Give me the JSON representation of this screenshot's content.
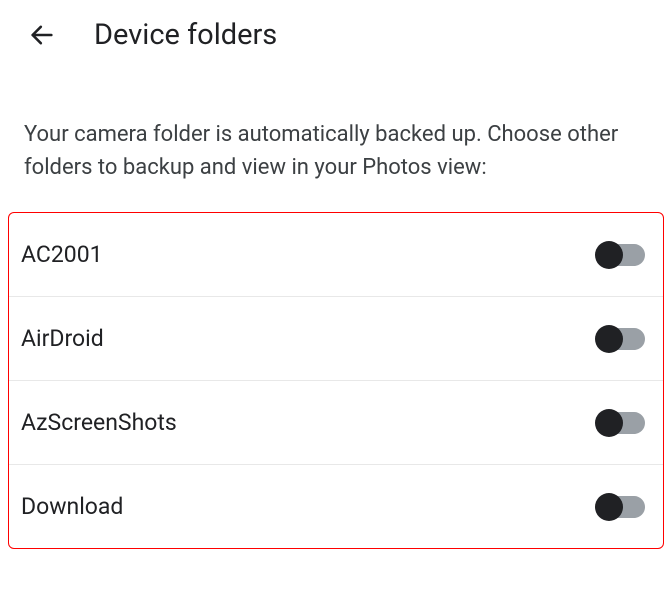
{
  "header": {
    "title": "Device folders"
  },
  "description": "Your camera folder is automatically backed up. Choose other folders to backup and view in your Photos view:",
  "folders": [
    {
      "label": "AC2001",
      "enabled": false
    },
    {
      "label": "AirDroid",
      "enabled": false
    },
    {
      "label": "AzScreenShots",
      "enabled": false
    },
    {
      "label": "Download",
      "enabled": false
    }
  ]
}
